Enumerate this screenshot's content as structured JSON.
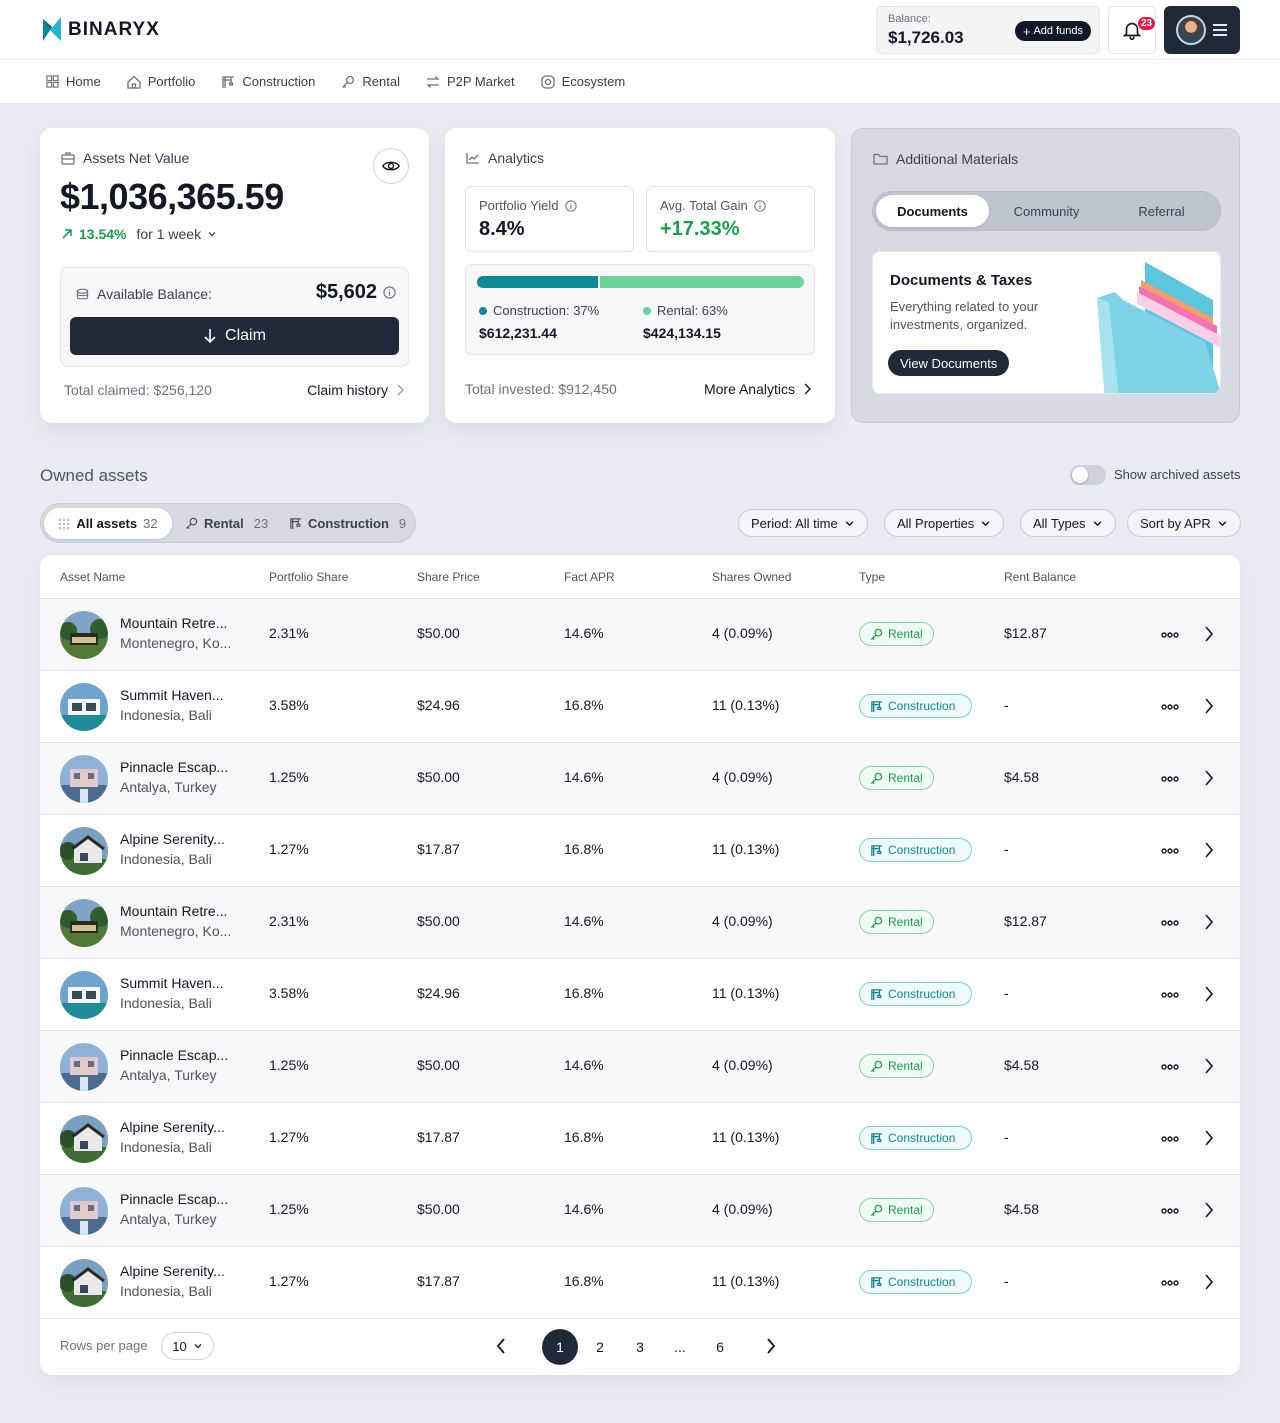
{
  "header": {
    "logo": "BINARYX",
    "balance_label": "Balance:",
    "balance_value": "$1,726.03",
    "add_funds": "Add funds",
    "notifications": "23"
  },
  "nav": [
    {
      "label": "Home",
      "icon": "grid-icon"
    },
    {
      "label": "Portfolio",
      "icon": "home-icon"
    },
    {
      "label": "Construction",
      "icon": "crane-icon"
    },
    {
      "label": "Rental",
      "icon": "key-icon"
    },
    {
      "label": "P2P Market",
      "icon": "swap-icon"
    },
    {
      "label": "Ecosystem",
      "icon": "ecosystem-icon"
    }
  ],
  "net_value": {
    "title": "Assets Net Value",
    "value": "$1,036,365.59",
    "change": "13.54%",
    "period": "for 1 week",
    "available_label": "Available Balance:",
    "available_value": "$5,602",
    "claim": "Claim",
    "total_claimed": "Total claimed: $256,120",
    "claim_history": "Claim history"
  },
  "analytics": {
    "title": "Analytics",
    "yield_label": "Portfolio Yield",
    "yield_value": "8.4%",
    "gain_label": "Avg. Total Gain",
    "gain_value": "+17.33%",
    "construction_label": "Construction: 37%",
    "construction_value": "$612,231.44",
    "rental_label": "Rental: 63%",
    "rental_value": "$424,134.15",
    "construction_share": 0.37,
    "total_invested": "Total invested: $912,450",
    "more": "More Analytics",
    "colors": {
      "construction": "#0e8a96",
      "rental": "#6dd39a"
    }
  },
  "materials": {
    "title": "Additional Materials",
    "tabs": [
      "Documents",
      "Community",
      "Referral"
    ],
    "doc_title": "Documents & Taxes",
    "doc_text": "Everything related to your investments, organized.",
    "doc_button": "View Documents"
  },
  "owned": {
    "title": "Owned assets",
    "archived_label": "Show archived assets",
    "tabs": [
      {
        "label": "All assets",
        "count": "32"
      },
      {
        "label": "Rental",
        "count": "23"
      },
      {
        "label": "Construction",
        "count": "9"
      }
    ],
    "filters": [
      "Period: All time",
      "All Properties",
      "All Types",
      "Sort by APR"
    ]
  },
  "table": {
    "headers": [
      "Asset Name",
      "Portfolio Share",
      "Share Price",
      "Fact APR",
      "Shares Owned",
      "Type",
      "Rent Balance"
    ],
    "rows": [
      {
        "name": "Mountain Retre...",
        "loc": "Montenegro, Ko...",
        "share": "2.31%",
        "price": "$50.00",
        "apr": "14.6%",
        "owned": "4 (0.09%)",
        "type": "Rental",
        "rent": "$12.87"
      },
      {
        "name": "Summit Haven...",
        "loc": "Indonesia, Bali",
        "share": "3.58%",
        "price": "$24.96",
        "apr": "16.8%",
        "owned": "11 (0.13%)",
        "type": "Construction",
        "rent": "-"
      },
      {
        "name": "Pinnacle Escap...",
        "loc": "Antalya, Turkey",
        "share": "1.25%",
        "price": "$50.00",
        "apr": "14.6%",
        "owned": "4 (0.09%)",
        "type": "Rental",
        "rent": "$4.58"
      },
      {
        "name": "Alpine Serenity...",
        "loc": "Indonesia, Bali",
        "share": "1.27%",
        "price": "$17.87",
        "apr": "16.8%",
        "owned": "11 (0.13%)",
        "type": "Construction",
        "rent": "-"
      },
      {
        "name": "Mountain Retre...",
        "loc": "Montenegro, Ko...",
        "share": "2.31%",
        "price": "$50.00",
        "apr": "14.6%",
        "owned": "4 (0.09%)",
        "type": "Rental",
        "rent": "$12.87"
      },
      {
        "name": "Summit Haven...",
        "loc": "Indonesia, Bali",
        "share": "3.58%",
        "price": "$24.96",
        "apr": "16.8%",
        "owned": "11 (0.13%)",
        "type": "Construction",
        "rent": "-"
      },
      {
        "name": "Pinnacle Escap...",
        "loc": "Antalya, Turkey",
        "share": "1.25%",
        "price": "$50.00",
        "apr": "14.6%",
        "owned": "4 (0.09%)",
        "type": "Rental",
        "rent": "$4.58"
      },
      {
        "name": "Alpine Serenity...",
        "loc": "Indonesia, Bali",
        "share": "1.27%",
        "price": "$17.87",
        "apr": "16.8%",
        "owned": "11 (0.13%)",
        "type": "Construction",
        "rent": "-"
      },
      {
        "name": "Pinnacle Escap...",
        "loc": "Antalya, Turkey",
        "share": "1.25%",
        "price": "$50.00",
        "apr": "14.6%",
        "owned": "4 (0.09%)",
        "type": "Rental",
        "rent": "$4.58"
      },
      {
        "name": "Alpine Serenity...",
        "loc": "Indonesia, Bali",
        "share": "1.27%",
        "price": "$17.87",
        "apr": "16.8%",
        "owned": "11 (0.13%)",
        "type": "Construction",
        "rent": "-"
      }
    ],
    "rows_per_page_label": "Rows per page",
    "rows_per_page": "10",
    "pages": [
      "1",
      "2",
      "3",
      "...",
      "6"
    ],
    "current_page": "1"
  }
}
